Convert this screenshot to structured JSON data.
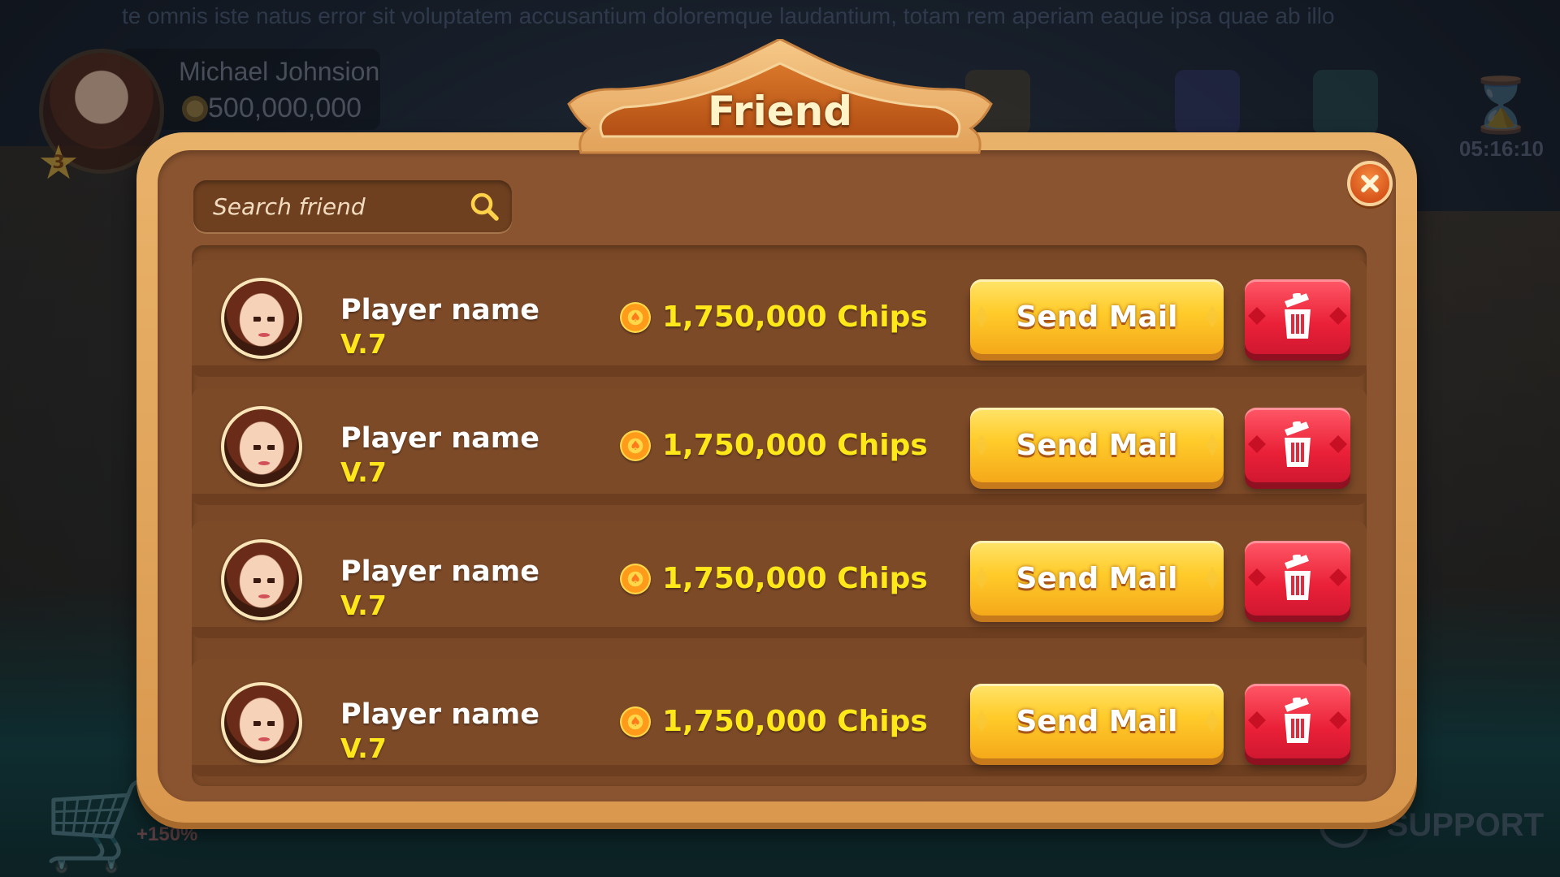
{
  "background": {
    "marquee": "te omnis iste natus error sit voluptatem accusantium doloremque laudantium, totam rem aperiam eaque ipsa quae ab illo",
    "profile": {
      "name": "Michael Johnsion",
      "coins": "500,000,000",
      "level": "3"
    },
    "timer": "05:16:10",
    "bonus": "+150%",
    "support_label": "SUPPORT"
  },
  "dialog": {
    "title": "Friend",
    "search": {
      "placeholder": "Search friend",
      "value": ""
    },
    "friends": [
      {
        "name": "Player name",
        "level": "V.7",
        "chips": "1,750,000 Chips",
        "send_label": "Send Mail"
      },
      {
        "name": "Player name",
        "level": "V.7",
        "chips": "1,750,000 Chips",
        "send_label": "Send Mail"
      },
      {
        "name": "Player name",
        "level": "V.7",
        "chips": "1,750,000 Chips",
        "send_label": "Send Mail"
      },
      {
        "name": "Player name",
        "level": "V.7",
        "chips": "1,750,000 Chips",
        "send_label": "Send Mail"
      }
    ]
  },
  "colors": {
    "frame": "#e9b26a",
    "panel": "#8a5430",
    "send_button": "#ffcb2a",
    "delete_button": "#ea2038",
    "level_text": "#ffe61a",
    "chips_text": "#ffe81a"
  },
  "icons": [
    "search-icon",
    "close-icon",
    "trash-icon",
    "chip-icon",
    "avatar"
  ]
}
